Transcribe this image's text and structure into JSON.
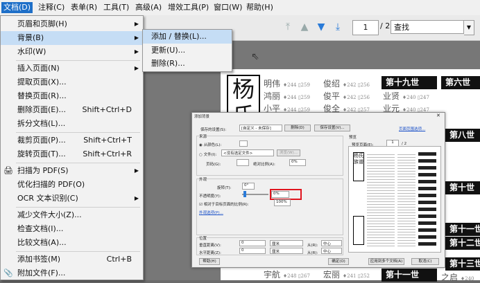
{
  "menubar": [
    "文档(D)",
    "注释(C)",
    "表单(R)",
    "工具(T)",
    "高级(A)",
    "增效工具(P)",
    "窗口(W)",
    "帮助(H)"
  ],
  "toolbar": {
    "page_value": "1",
    "page_total": "/ 2",
    "find_placeholder": "查找"
  },
  "doc_menu": {
    "items": [
      {
        "label": "页眉和页脚(H)",
        "shortcut": "",
        "submenu": true
      },
      {
        "label": "背景(B)",
        "shortcut": "",
        "submenu": true,
        "highlighted": true
      },
      {
        "label": "水印(W)",
        "shortcut": "",
        "submenu": true
      },
      {
        "label": "插入页面(N)",
        "shortcut": "",
        "submenu": true
      },
      {
        "label": "提取页面(X)...",
        "shortcut": ""
      },
      {
        "label": "替换页面(R)...",
        "shortcut": ""
      },
      {
        "label": "删除页面(E)...",
        "shortcut": "Shift+Ctrl+D"
      },
      {
        "label": "拆分文档(L)...",
        "shortcut": ""
      },
      {
        "label": "裁剪页面(P)...",
        "shortcut": "Shift+Ctrl+T"
      },
      {
        "label": "旋转页面(T)...",
        "shortcut": "Shift+Ctrl+R"
      },
      {
        "label": "扫描为 PDF(S)",
        "shortcut": "",
        "submenu": true
      },
      {
        "label": "优化扫描的 PDF(O)",
        "shortcut": ""
      },
      {
        "label": "OCR 文本识别(C)",
        "shortcut": "",
        "submenu": true
      },
      {
        "label": "减少文件大小(Z)...",
        "shortcut": ""
      },
      {
        "label": "检查文档(I)...",
        "shortcut": ""
      },
      {
        "label": "比较文档(A)...",
        "shortcut": ""
      },
      {
        "label": "添加书签(M)",
        "shortcut": "Ctrl+B"
      },
      {
        "label": "附加文件(F)...",
        "shortcut": ""
      }
    ]
  },
  "bg_submenu": [
    "添加 / 替换(L)...",
    "更新(U)...",
    "删除(R)..."
  ],
  "document": {
    "big_char": "杨\n氏",
    "names": [
      [
        "明伟",
        "俊绍"
      ],
      [
        "鸿丽",
        "俊平"
      ],
      [
        "小平",
        "俊全"
      ]
    ],
    "ranks": [
      "第十九世",
      "第六世",
      "第八世",
      "第十世",
      "第十一世",
      "第十二世",
      "第十三世",
      "第十一世"
    ],
    "right_col": [
      "业贤",
      "业元"
    ],
    "bottom_names": [
      "宇航",
      "宏丽",
      "之启"
    ]
  },
  "dialog": {
    "title": "添加背景",
    "saved_label": "保存的设置(S):",
    "saved_value": "[自定义 - 未保存]",
    "delete_btn": "删除(D)",
    "save_btn": "保存设置(V)...",
    "page_range_link": "页面范围选项...",
    "source_label": "来源",
    "from_color": "从颜色(L):",
    "file_label": "文件(I):",
    "file_value": "<没有选定文件>",
    "browse_btn": "浏览(W)...",
    "page_num_label": "页码(G):",
    "abs_scale": "绝对比例(A):",
    "abs_value": "0%",
    "appearance_label": "外观",
    "rotation_label": "旋转(T):",
    "rotation_value": "0°",
    "opacity_label": "不透明度(Y):",
    "opacity_value": "0%",
    "scale_checkbox": "相对于目标页面的比例(R):",
    "scale_value": "100%",
    "appearance_link": "外观选项(P)...",
    "position_label": "位置",
    "vdist_label": "垂直距离(V):",
    "vdist_value": "0",
    "hdist_label": "水平距离(Z):",
    "hdist_value": "0",
    "unit": "厘米",
    "from_label": "从(R):",
    "from_value": "中心",
    "preview_label": "预览",
    "preview_page_label": "预览页面(E):",
    "preview_page": "1",
    "preview_total": "/ 2",
    "help_btn": "帮助(H)",
    "ok_btn": "确定(O)",
    "apply_btn": "应用到多个文档(A)",
    "cancel_btn": "取消(C)"
  }
}
